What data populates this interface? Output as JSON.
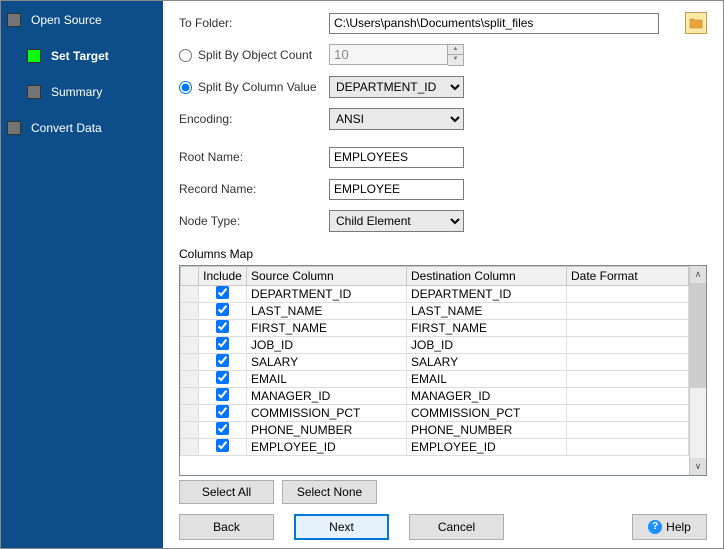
{
  "sidebar": {
    "items": [
      {
        "label": "Open Source",
        "state": "done"
      },
      {
        "label": "Set Target",
        "state": "active"
      },
      {
        "label": "Summary",
        "state": "pending"
      },
      {
        "label": "Convert Data",
        "state": "pending"
      }
    ]
  },
  "form": {
    "to_folder_label": "To Folder:",
    "to_folder_value": "C:\\Users\\pansh\\Documents\\split_files",
    "split_count_label": "Split By Object Count",
    "split_count_value": "10",
    "split_column_label": "Split By Column Value",
    "split_column_value": "DEPARTMENT_ID",
    "encoding_label": "Encoding:",
    "encoding_value": "ANSI",
    "root_name_label": "Root Name:",
    "root_name_value": "EMPLOYEES",
    "record_name_label": "Record Name:",
    "record_name_value": "EMPLOYEE",
    "node_type_label": "Node Type:",
    "node_type_value": "Child Element"
  },
  "columns_map_label": "Columns Map",
  "grid": {
    "headers": {
      "include": "Include",
      "source": "Source Column",
      "dest": "Destination Column",
      "date": "Date Format"
    },
    "rows": [
      {
        "include": true,
        "source": "DEPARTMENT_ID",
        "dest": "DEPARTMENT_ID",
        "date": ""
      },
      {
        "include": true,
        "source": "LAST_NAME",
        "dest": "LAST_NAME",
        "date": ""
      },
      {
        "include": true,
        "source": "FIRST_NAME",
        "dest": "FIRST_NAME",
        "date": ""
      },
      {
        "include": true,
        "source": "JOB_ID",
        "dest": "JOB_ID",
        "date": ""
      },
      {
        "include": true,
        "source": "SALARY",
        "dest": "SALARY",
        "date": ""
      },
      {
        "include": true,
        "source": "EMAIL",
        "dest": "EMAIL",
        "date": ""
      },
      {
        "include": true,
        "source": "MANAGER_ID",
        "dest": "MANAGER_ID",
        "date": ""
      },
      {
        "include": true,
        "source": "COMMISSION_PCT",
        "dest": "COMMISSION_PCT",
        "date": ""
      },
      {
        "include": true,
        "source": "PHONE_NUMBER",
        "dest": "PHONE_NUMBER",
        "date": ""
      },
      {
        "include": true,
        "source": "EMPLOYEE_ID",
        "dest": "EMPLOYEE_ID",
        "date": ""
      }
    ]
  },
  "buttons": {
    "select_all": "Select All",
    "select_none": "Select None",
    "back": "Back",
    "next": "Next",
    "cancel": "Cancel",
    "help": "Help"
  }
}
